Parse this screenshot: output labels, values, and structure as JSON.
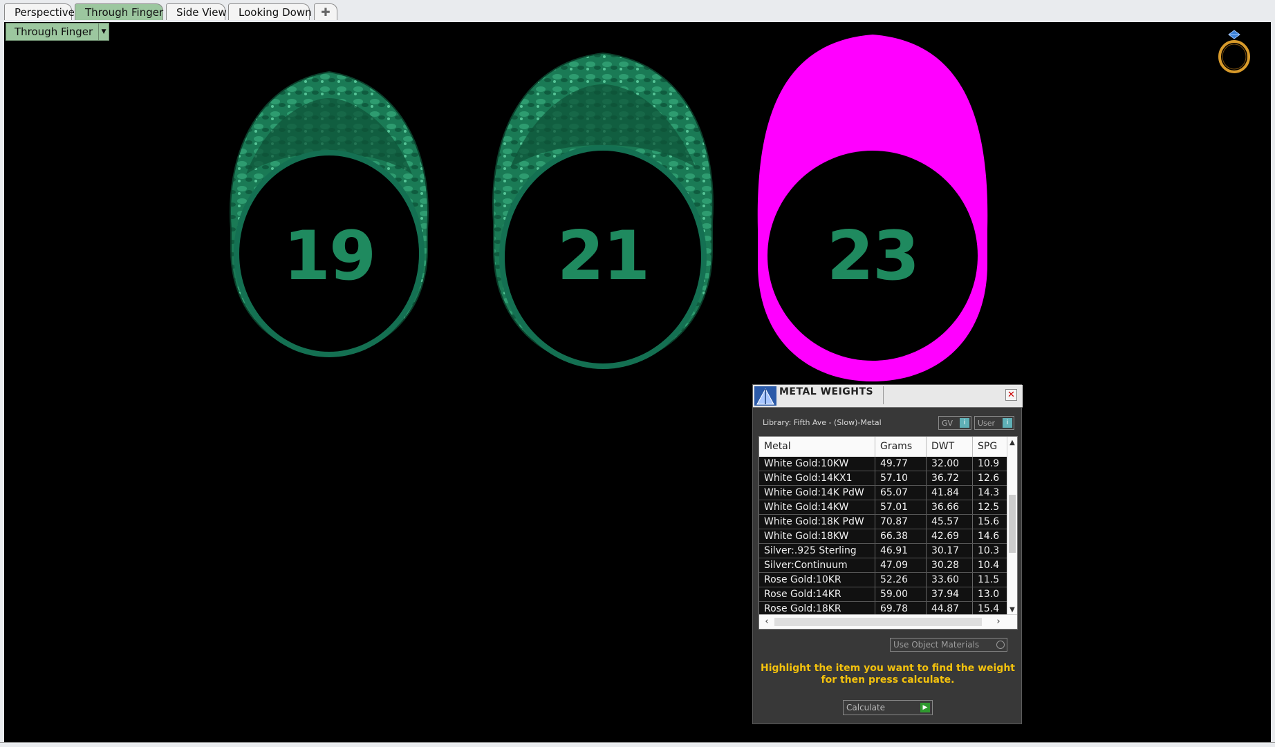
{
  "tabs": [
    {
      "label": "Perspective",
      "active": false
    },
    {
      "label": "Through Finger",
      "active": true
    },
    {
      "label": "Side View",
      "active": false
    },
    {
      "label": "Looking Down",
      "active": false
    }
  ],
  "add_tab_symbol": "✚",
  "viewport": {
    "dropdown_label": "Through Finger",
    "dropdown_arrow": "▼",
    "ring_icon": "ring-icon",
    "ring_sizes": [
      "19",
      "21",
      "23"
    ],
    "highlight_color": "#ff00ff",
    "ring_color": "#1a7a55"
  },
  "metal_weights": {
    "title": "METAL WEIGHTS",
    "close_symbol": "✕",
    "library_label": "Library: Fifth Ave - (Slow)-Metal",
    "gv_label": "GV",
    "user_label": "User",
    "columns": [
      "Metal",
      "Grams",
      "DWT",
      "SPG"
    ],
    "rows": [
      [
        "White Gold:10KW",
        "49.77",
        "32.00",
        "10.9"
      ],
      [
        "White Gold:14KX1",
        "57.10",
        "36.72",
        "12.6"
      ],
      [
        "White Gold:14K PdW",
        "65.07",
        "41.84",
        "14.3"
      ],
      [
        "White Gold:14KW",
        "57.01",
        "36.66",
        "12.5"
      ],
      [
        "White Gold:18K PdW",
        "70.87",
        "45.57",
        "15.6"
      ],
      [
        "White Gold:18KW",
        "66.38",
        "42.69",
        "14.6"
      ],
      [
        "Silver:.925 Sterling",
        "46.91",
        "30.17",
        "10.3"
      ],
      [
        "Silver:Continuum",
        "47.09",
        "30.28",
        "10.4"
      ],
      [
        "Rose Gold:10KR",
        "52.26",
        "33.60",
        "11.5"
      ],
      [
        "Rose Gold:14KR",
        "59.00",
        "37.94",
        "13.0"
      ],
      [
        "Rose Gold:18KR",
        "69.78",
        "44.87",
        "15.4"
      ]
    ],
    "use_object_materials": "Use Object Materials",
    "instruction": "Highlight the item you want to find the weight for then press calculate.",
    "calculate_label": "Calculate",
    "accent_color": "#f4c20d"
  }
}
